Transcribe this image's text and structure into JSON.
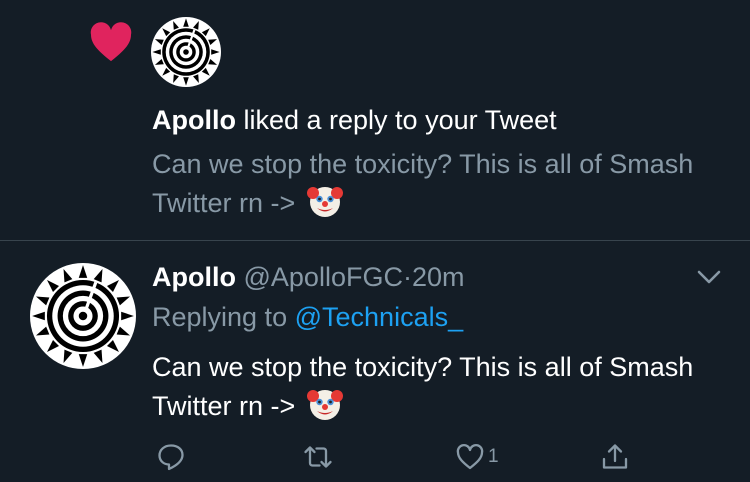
{
  "notification": {
    "type_icon": "heart-icon",
    "heart_color": "#e0245e",
    "actor": "Apollo",
    "action_text": " liked a reply to your Tweet",
    "body_text": "Can we stop the toxicity? This is all of Smash Twitter rn ->",
    "emoji": "clown-face"
  },
  "tweet": {
    "author_name": "Apollo",
    "handle": "@ApolloFGC",
    "separator": "·",
    "time": "20m",
    "replying_prefix": "Replying to",
    "replying_to": "@Technicals_",
    "text": "Can we stop the toxicity? This is all of Smash Twitter rn ->",
    "emoji": "clown-face",
    "actions": {
      "reply_icon": "reply-icon",
      "retweet_icon": "retweet-icon",
      "like_icon": "like-icon",
      "like_count": "1",
      "share_icon": "share-icon"
    }
  },
  "colors": {
    "background": "#141d26",
    "secondary_text": "#8899a6",
    "link": "#1da1f2",
    "divider": "#38444d"
  }
}
